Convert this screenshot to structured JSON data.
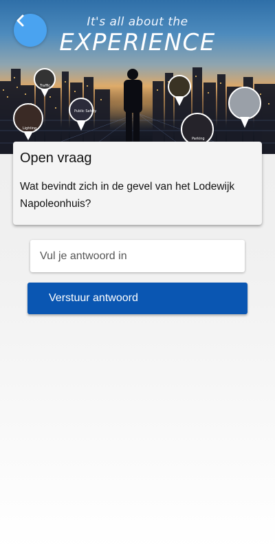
{
  "hero": {
    "tagline_line1": "It's all about the",
    "tagline_line2": "EXPERIENCE",
    "pins": [
      {
        "label": "Traffic"
      },
      {
        "label": "Lighting"
      },
      {
        "label": "Public Safety"
      },
      {
        "label": ""
      },
      {
        "label": "Parking"
      },
      {
        "label": ""
      }
    ]
  },
  "back_button": {
    "icon": "chevron-left-icon",
    "color": "#4aa3f0"
  },
  "question_card": {
    "title": "Open vraag",
    "question": "Wat bevindt zich in de gevel van het Lodewijk Napoleonhuis?"
  },
  "answer": {
    "placeholder": "Vul je antwoord in",
    "value": ""
  },
  "submit": {
    "label": "Verstuur antwoord",
    "color": "#0a56b2"
  }
}
